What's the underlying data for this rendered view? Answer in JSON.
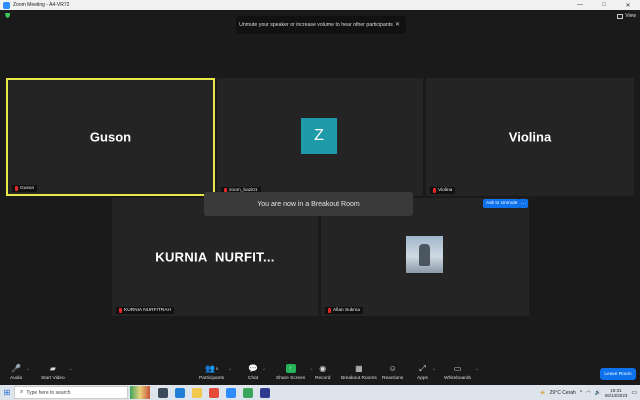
{
  "window": {
    "title": "Zoom Meeting - A4-VR72",
    "controls": [
      "—",
      "□",
      "✕"
    ]
  },
  "top_bar": {
    "view_label": "View",
    "notification": {
      "text": "Unmute your speaker or increase volume to hear other participants",
      "close": "✕"
    }
  },
  "participants": [
    {
      "big_name": "Guson",
      "label": "Guson"
    },
    {
      "avatar_letter": "Z",
      "label": "zoom_bazi01"
    },
    {
      "big_name": "Violina",
      "label": "Violina"
    },
    {
      "big_name": "KURNIA  NURFIT...",
      "label": "KURNIA NURFITRAH"
    },
    {
      "label": "Allan Sukma"
    }
  ],
  "breakout_banner": "You are now in a Breakout Room",
  "ask_to_unmute": "Ask to Unmute",
  "more_label": "···",
  "toolbar": {
    "audio": "Audio",
    "start_video": "Start Video",
    "participants": "Participants",
    "participants_count": "5",
    "chat": "Chat",
    "share_screen": "Share Screen",
    "record": "Record",
    "breakout_rooms": "Breakout Rooms",
    "reactions": "Reactions",
    "apps": "Apps",
    "whiteboards": "Whiteboards",
    "leave": "Leave Room"
  },
  "taskbar": {
    "search_placeholder": "Type here to search",
    "weather": "29°C  Cerah",
    "time": "19:31",
    "date": "06/13/2023"
  },
  "colors": {
    "active_speaker_border": "#e8e84a",
    "accent_blue": "#0e72ed",
    "avatar_teal": "#1f9aa8",
    "share_green": "#25b35a"
  }
}
